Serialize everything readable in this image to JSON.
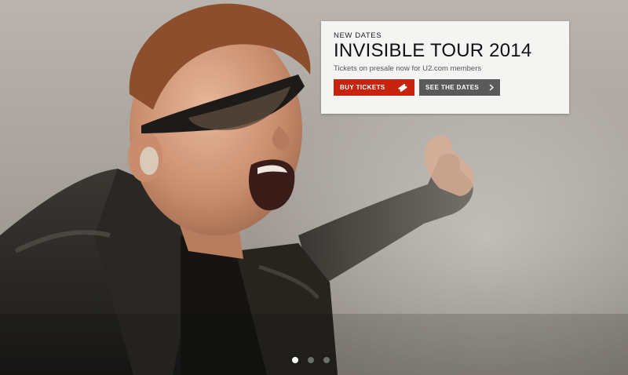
{
  "hero": {
    "image_description": "Singer in leather jacket and wraparound sunglasses shouting into the crowd with arm outstretched"
  },
  "promo": {
    "eyebrow": "NEW DATES",
    "title": "INVISIBLE TOUR 2014",
    "subtitle": "Tickets on presale now for U2.com members",
    "buy_button": {
      "label": "BUY TICKETS",
      "icon": "ticket-icon"
    },
    "dates_button": {
      "label": "SEE THE DATES",
      "icon": "chevron-right-icon"
    }
  },
  "carousel": {
    "slide_count": 3,
    "active_index": 0
  },
  "colors": {
    "buy_button": "#c8230f",
    "dates_button": "#5a5a5a",
    "panel": "#f4f4f2"
  }
}
